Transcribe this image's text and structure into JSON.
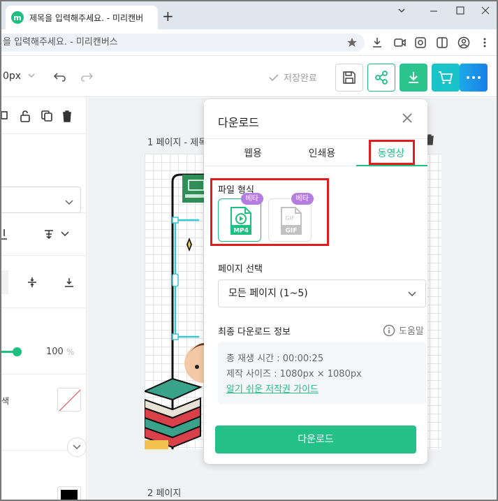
{
  "browser": {
    "tab_title": "제목을 입력해주세요. - 미리캔버",
    "favicon_letter": "m",
    "new_tab": "+",
    "url": "을 입력해주세요. - 미리캔버스"
  },
  "toolbar": {
    "zoom": "0px",
    "saved_label": "저장완료"
  },
  "left_panel": {
    "opacity_value": "100",
    "opacity_unit": "%",
    "color_label": "색"
  },
  "canvas": {
    "page1_label": "1 페이지 - 제목",
    "page2_label": "2 페이지"
  },
  "download": {
    "title": "다운로드",
    "tabs": [
      "웹용",
      "인쇄용",
      "동영상"
    ],
    "active_tab": "동영상",
    "file_format_label": "파일 형식",
    "formats": [
      {
        "label": "MP4",
        "badge": "베타"
      },
      {
        "label": "GIF",
        "badge": "베타"
      }
    ],
    "page_select_label": "페이지 선택",
    "page_select_value": "모든 페이지 (1~5)",
    "final_info_label": "최종 다운로드 정보",
    "help_label": "도움말",
    "play_time": "총 재생 시간 : 00:00:25",
    "size": "제작 사이즈 : 1080px × 1080px",
    "guide_link": "알기 쉬운 저작권 가이드",
    "button": "다운로드"
  },
  "colors": {
    "accent": "#1fbf82",
    "highlight": "#e01c1c",
    "beta": "#b57de0",
    "share": "#1fbf82",
    "download_btn": "#25c08a",
    "premium": "#1a7fe8"
  }
}
